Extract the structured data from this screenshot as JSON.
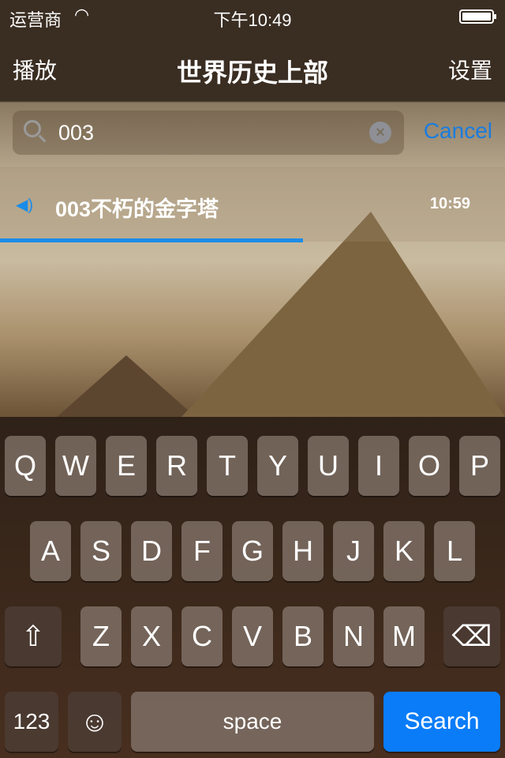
{
  "status_bar": {
    "carrier": "运营商",
    "wifi_icon": "wifi-icon",
    "time": "下午10:49",
    "battery_level": 1.0
  },
  "nav": {
    "left": "播放",
    "title": "世界历史上部",
    "right": "设置"
  },
  "search": {
    "value": "003",
    "placeholder": "",
    "cancel": "Cancel"
  },
  "results": [
    {
      "icon": "speaker-icon",
      "title": "003不朽的金字塔",
      "duration": "10:59",
      "progress": 0.6
    }
  ],
  "keyboard": {
    "row1": [
      "Q",
      "W",
      "E",
      "R",
      "T",
      "Y",
      "U",
      "I",
      "O",
      "P"
    ],
    "row2": [
      "A",
      "S",
      "D",
      "F",
      "G",
      "H",
      "J",
      "K",
      "L"
    ],
    "row3": [
      "Z",
      "X",
      "C",
      "V",
      "B",
      "N",
      "M"
    ],
    "numbers": "123",
    "emoji_icon": "☺",
    "space": "space",
    "search": "Search"
  },
  "colors": {
    "accent": "#1a8ce8",
    "search_key": "#0a7cf8"
  }
}
